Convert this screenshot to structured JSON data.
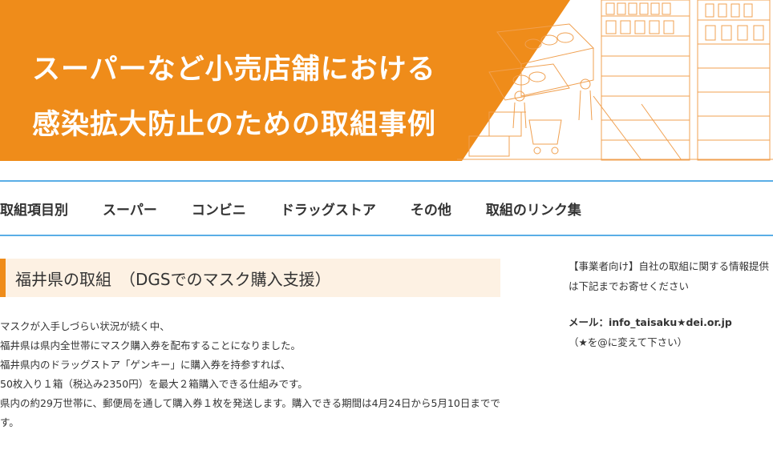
{
  "banner": {
    "title_line1": "スーパーなど小売店舗における",
    "title_line2": "感染拡大防止のための取組事例",
    "accent_color": "#ef8c1a"
  },
  "nav": {
    "items": [
      "取組項目別",
      "スーパー",
      "コンビニ",
      "ドラッグストア",
      "その他",
      "取組のリンク集"
    ],
    "line_color": "#5aaee6"
  },
  "main": {
    "heading": "福井県の取組　（DGSでのマスク購入支援）",
    "paragraphs": [
      "マスクが入手しづらい状況が続く中、",
      "福井県は県内全世帯にマスク購入券を配布することになりました。",
      "福井県内のドラッグストア「ゲンキー」に購入券を持参すれば、",
      "50枚入り１箱（税込み2350円）を最大２箱購入できる仕組みです。",
      "県内の約29万世帯に、郵便局を通して購入券１枚を発送します。購入できる期間は4月24日から5月10日までです。"
    ]
  },
  "sidebar": {
    "info_text": "【事業者向け】自社の取組に関する情報提供は下記までお寄せください",
    "mail_label": "メール：info_taisaku★dei.or.jp",
    "mail_note": "（★を@に変えて下さい）"
  }
}
